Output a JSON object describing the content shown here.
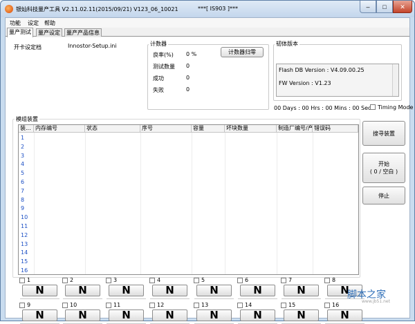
{
  "window": {
    "title": "银灿科技量产工具 V2.11.02.11(2015/09/21)    V123_06_10021",
    "center_title": "***[ IS903 ]***",
    "min_label": "–",
    "max_label": "□",
    "close_label": "✕"
  },
  "menu": [
    "功能",
    "设定",
    "帮助"
  ],
  "tabs": [
    "量产测试",
    "量产设定",
    "量产产品信息"
  ],
  "settings": {
    "label": "开卡设定档",
    "value": "Innostor-Setup.ini"
  },
  "counter": {
    "title": "计数器",
    "reset_button": "计数器归零",
    "rows": [
      {
        "label": "良率(%)",
        "value": "0 %"
      },
      {
        "label": "测试数量",
        "value": "0"
      },
      {
        "label": "成功",
        "value": "0"
      },
      {
        "label": "失败",
        "value": "0"
      }
    ]
  },
  "firmware": {
    "title": "韧体版本",
    "flash_db": "Flash DB Version :  V4.09.00.25",
    "fw": "FW Version :    V1.23"
  },
  "timer": "00 Days : 00 Hrs : 00 Mins : 00 Secs",
  "timing_mode": "Timing Mode",
  "devices": {
    "title": "模组装置",
    "columns": [
      "装...",
      "内存编号",
      "状态",
      "序号",
      "容量",
      "坏块数量",
      "制造厂编号/产...",
      "错误码"
    ],
    "rows": [
      "1",
      "2",
      "3",
      "4",
      "5",
      "6",
      "7",
      "8",
      "9",
      "10",
      "11",
      "12",
      "13",
      "14",
      "15",
      "16"
    ]
  },
  "actions": {
    "search": "搜寻装置",
    "start_line1": "开始",
    "start_line2": "( 0 / 空白 )",
    "stop": "停止"
  },
  "slots": {
    "labels": [
      "1",
      "2",
      "3",
      "4",
      "5",
      "6",
      "7",
      "8",
      "9",
      "10",
      "11",
      "12",
      "13",
      "14",
      "15",
      "16"
    ],
    "button_text": "N"
  },
  "watermark": {
    "logo": "脚本之家",
    "url": "www.jb51.net"
  },
  "colors": {
    "row_number": "#1a4ec4",
    "watermark": "#2f6fb8"
  }
}
